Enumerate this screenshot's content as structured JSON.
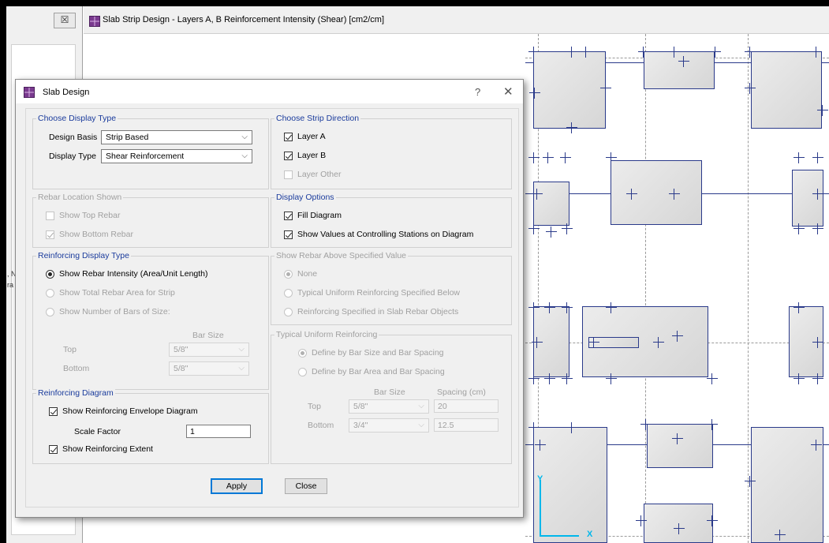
{
  "model_window": {
    "title": "Slab Strip Design - Layers A, B Reinforcement Intensity (Shear) [cm2/cm]",
    "icon": "app-grid-icon",
    "axes": {
      "y_label": "Y",
      "x_label": "X"
    }
  },
  "left_panel": {
    "close_glyph": "☒",
    "edge_fragments": [
      ", N",
      "ra"
    ]
  },
  "dialog": {
    "title": "Slab Design",
    "help_glyph": "?",
    "close_glyph": "✕",
    "display_type": {
      "title": "Choose Display Type",
      "design_basis_label": "Design Basis",
      "design_basis_value": "Strip Based",
      "display_type_label": "Display Type",
      "display_type_value": "Shear Reinforcement"
    },
    "strip_direction": {
      "title": "Choose Strip Direction",
      "layer_a": "Layer A",
      "layer_b": "Layer B",
      "layer_other": "Layer Other"
    },
    "rebar_location": {
      "title": "Rebar Location Shown",
      "show_top": "Show Top Rebar",
      "show_bottom": "Show Bottom Rebar"
    },
    "display_options": {
      "title": "Display Options",
      "fill_diagram": "Fill Diagram",
      "show_values": "Show Values at Controlling Stations on Diagram"
    },
    "reinforcing_display": {
      "title": "Reinforcing Display Type",
      "intensity": "Show Rebar Intensity (Area/Unit Length)",
      "total_area": "Show Total Rebar Area for Strip",
      "num_bars": "Show Number of Bars of Size:",
      "bar_size_header": "Bar Size",
      "top_label": "Top",
      "top_value": "5/8\"",
      "bottom_label": "Bottom",
      "bottom_value": "5/8\""
    },
    "rebar_above": {
      "title": "Show Rebar Above Specified Value",
      "none": "None",
      "typical": "Typical Uniform Reinforcing Specified Below",
      "slab_objects": "Reinforcing Specified in Slab Rebar Objects"
    },
    "typical_uniform": {
      "title": "Typical Uniform Reinforcing",
      "by_bar_size": "Define by Bar Size and Bar Spacing",
      "by_bar_area": "Define by Bar Area and Bar Spacing",
      "bar_size_header": "Bar Size",
      "spacing_header": "Spacing  (cm)",
      "top_label": "Top",
      "top_size": "5/8\"",
      "top_spacing": "20",
      "bottom_label": "Bottom",
      "bottom_size": "3/4\"",
      "bottom_spacing": "12.5"
    },
    "reinforcing_diagram": {
      "title": "Reinforcing Diagram",
      "show_envelope": "Show Reinforcing Envelope Diagram",
      "scale_factor_label": "Scale Factor",
      "scale_factor_value": "1",
      "show_extent": "Show Reinforcing Extent"
    },
    "buttons": {
      "apply": "Apply",
      "close": "Close"
    },
    "dropdown_arrow": "⌵"
  }
}
